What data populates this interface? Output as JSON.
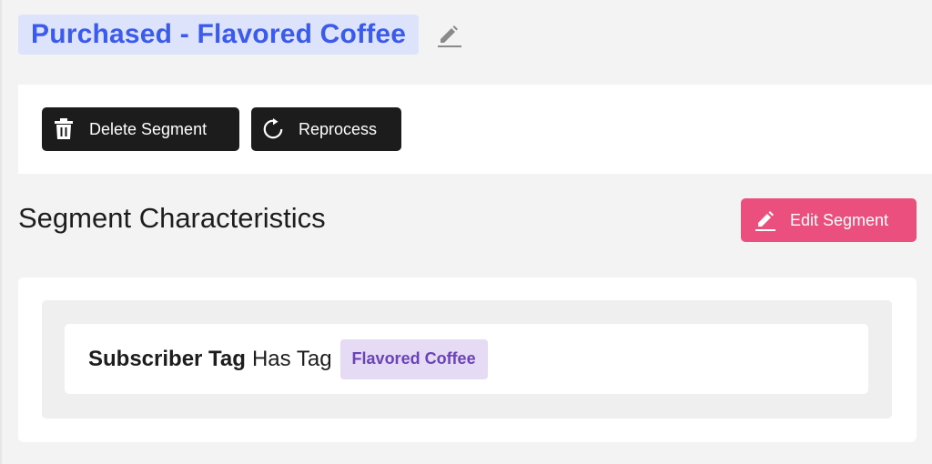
{
  "segment": {
    "title": "Purchased - Flavored Coffee",
    "title_edit_icon": "pencil-icon"
  },
  "actions": {
    "delete_label": "Delete Segment",
    "delete_icon": "trash-icon",
    "reprocess_label": "Reprocess",
    "reprocess_icon": "refresh-icon"
  },
  "characteristics": {
    "heading": "Segment Characteristics",
    "edit_label": "Edit Segment",
    "edit_icon": "pencil-icon",
    "rules": [
      {
        "field": "Subscriber Tag",
        "operator": "Has Tag",
        "value": "Flavored Coffee"
      }
    ]
  },
  "colors": {
    "title_text": "#3b5bec",
    "title_bg": "#dde3fb",
    "dark_button": "#1c1c1c",
    "edit_button": "#ea4f7d",
    "tag_text": "#6a43b8",
    "tag_bg": "#e5dbf4"
  }
}
